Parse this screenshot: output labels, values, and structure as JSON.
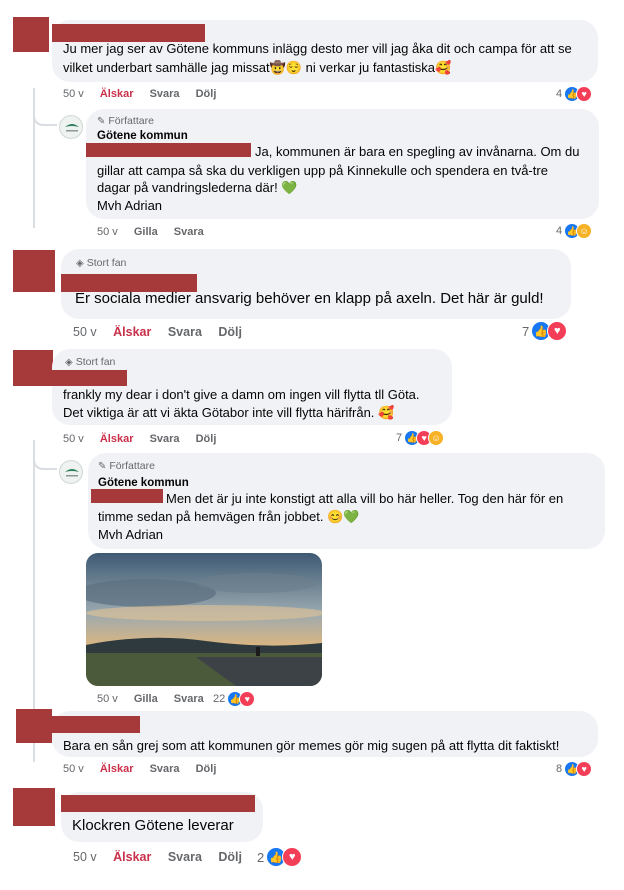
{
  "comments": [
    {
      "text_lines": [
        "Ju mer jag ser av Götene kommuns inlägg desto mer vill jag åka dit och campa för att se",
        "vilket underbart samhälle jag missat🤠😌 ni verkar ju fantastiska🥰"
      ],
      "age": "50 v",
      "actions": [
        "Älskar",
        "Svara",
        "Dölj"
      ],
      "reaction_count": "4"
    },
    {
      "author_badge": "Författare",
      "author_name": "Götene kommun",
      "text_lines": [
        "Ja, kommunen är bara en spegling av invånarna. Om du",
        "gillar att campa så ska du verkligen upp på Kinnekulle och spendera en två-tre",
        "dagar på vandringslederna där! 💚",
        "Mvh Adrian"
      ],
      "age": "50 v",
      "actions": [
        "Gilla",
        "Svara"
      ],
      "reaction_count": "4"
    },
    {
      "badge": "Stort fan",
      "text_lines": [
        "Er sociala medier ansvarig behöver en klapp på axeln. Det här är guld!"
      ],
      "age": "50 v",
      "actions": [
        "Älskar",
        "Svara",
        "Dölj"
      ],
      "reaction_count": "7"
    },
    {
      "badge": "Stort fan",
      "text_lines": [
        "frankly my dear i don't give a damn om ingen vill flytta tll Göta.",
        "Det viktiga är att vi äkta Götabor inte vill flytta härifrån. 🥰"
      ],
      "age": "50 v",
      "actions": [
        "Älskar",
        "Svara",
        "Dölj"
      ],
      "reaction_count": "7"
    },
    {
      "author_badge": "Författare",
      "author_name": "Götene kommun",
      "text_lines": [
        "Men det är ju inte konstigt att alla vill bo här heller. Tog den här för en",
        "timme sedan på hemvägen från jobbet. 😊💚",
        "Mvh Adrian"
      ],
      "age": "50 v",
      "actions": [
        "Gilla",
        "Svara"
      ],
      "reaction_count": "22"
    },
    {
      "text_lines": [
        "Bara en sån grej som att kommunen gör memes gör mig sugen på att flytta dit faktiskt!"
      ],
      "age": "50 v",
      "actions": [
        "Älskar",
        "Svara",
        "Dölj"
      ],
      "reaction_count": "8"
    },
    {
      "text_lines": [
        "Klockren Götene leverar"
      ],
      "age": "50 v",
      "actions": [
        "Älskar",
        "Svara",
        "Dölj"
      ],
      "reaction_count": "2"
    }
  ],
  "icons": {
    "like": "thumbs-up-icon",
    "love": "heart-icon",
    "care": "care-icon",
    "badge": "diamond-icon",
    "author": "pencil-icon"
  },
  "colors": {
    "love_action": "#c9304a",
    "like": "#1877f2",
    "heart": "#f33e58",
    "bubble": "#f0f2f5",
    "redaction": "#a63a3a"
  }
}
